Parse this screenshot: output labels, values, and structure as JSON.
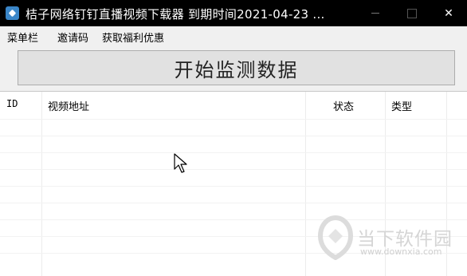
{
  "window": {
    "title": "桔子网络钉钉直播视频下载器   到期时间2021-04-23 ...",
    "close_glyph": "✕"
  },
  "menu": {
    "items": [
      {
        "label": "菜单栏"
      },
      {
        "label": "邀请码"
      },
      {
        "label": "获取福利优惠"
      }
    ]
  },
  "main": {
    "start_button_label": "开始监测数据"
  },
  "table": {
    "columns": [
      "ID",
      "视频地址",
      "状态",
      "类型"
    ],
    "rows": []
  },
  "watermark": {
    "text": "当下软件园",
    "url": "www.downxia.com"
  },
  "colors": {
    "titlebar_bg": "#000000",
    "app_icon": "#3a86c8",
    "button_bg": "#e1e1e1"
  }
}
